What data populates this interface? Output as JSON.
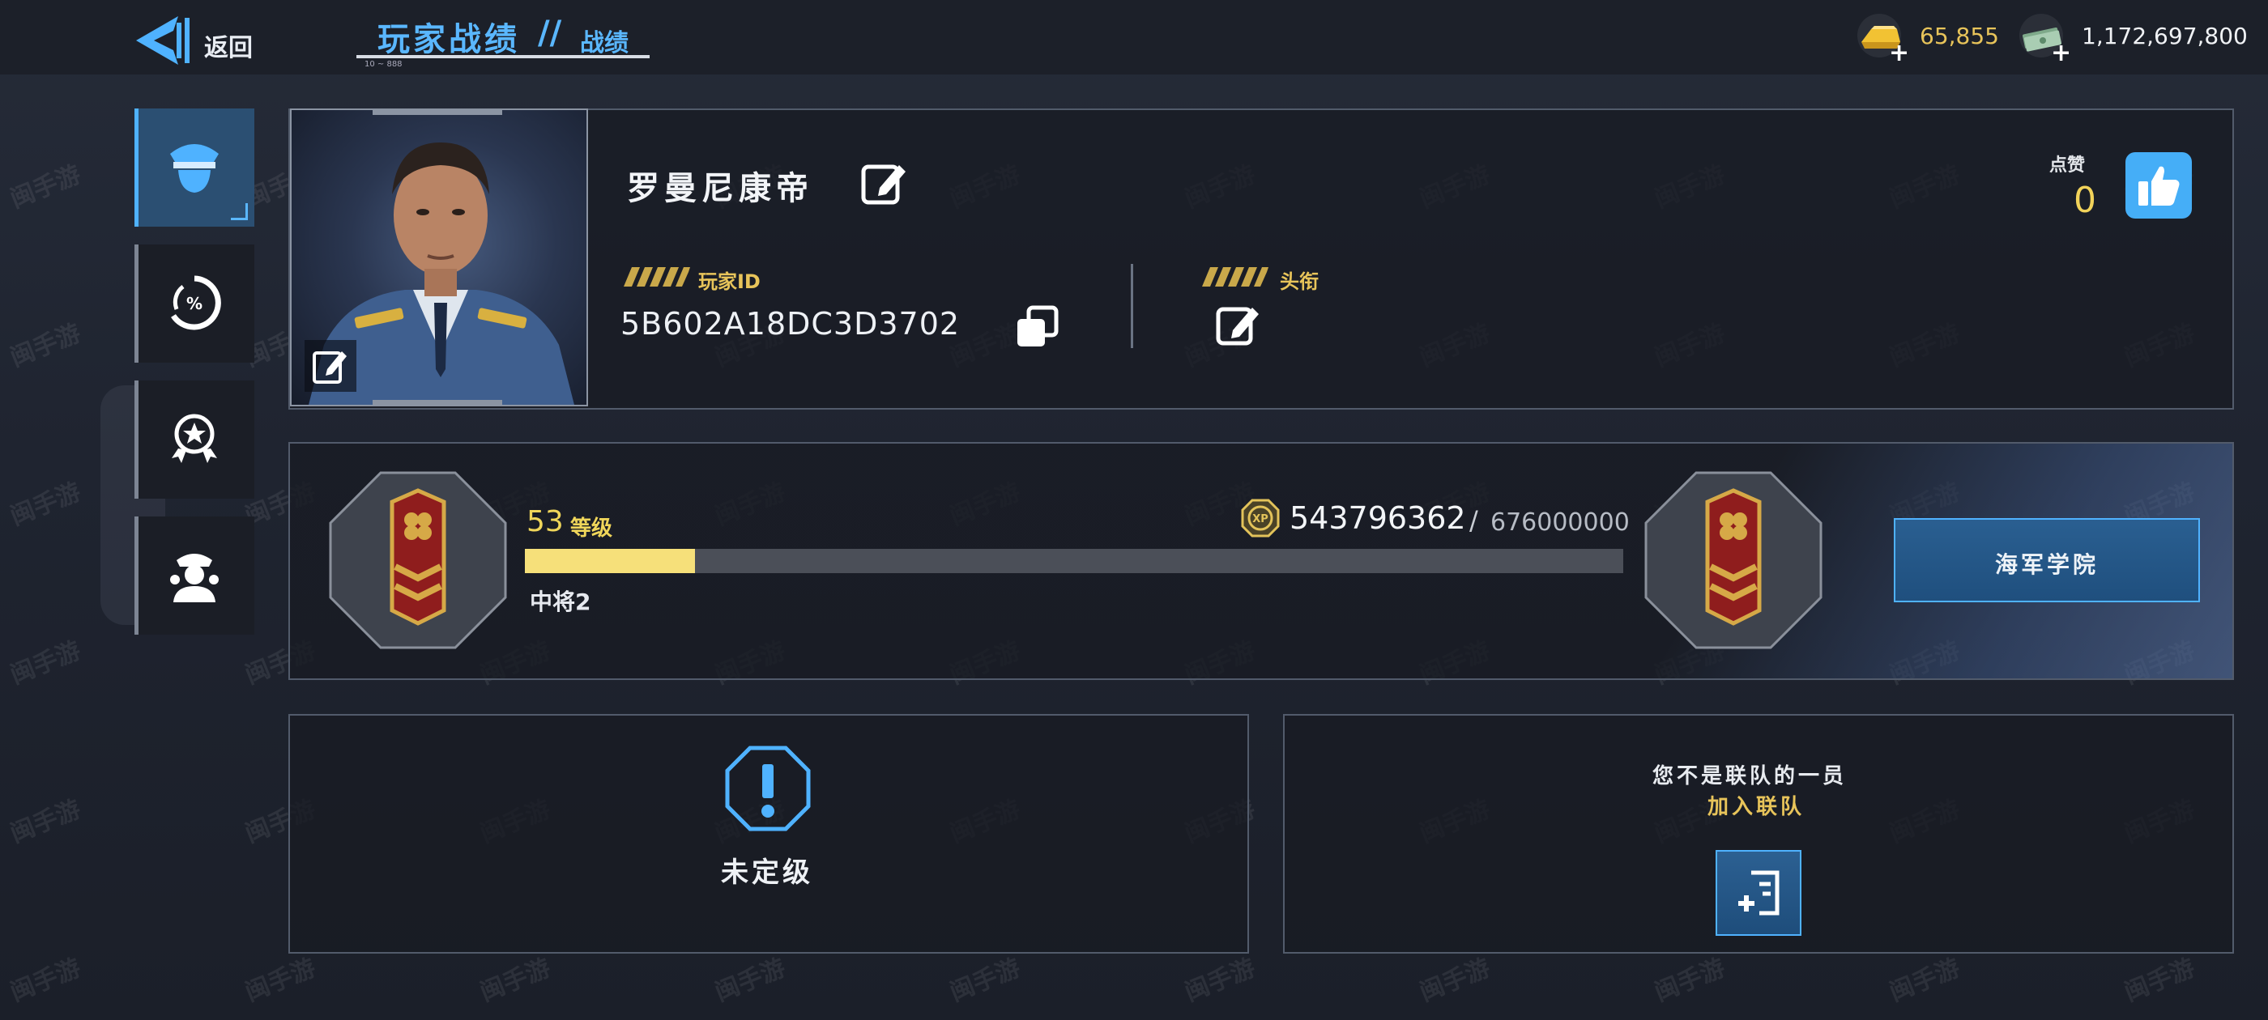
{
  "header": {
    "back_label": "返回",
    "title": "玩家战绩",
    "title_slash": "//",
    "subtitle": "战绩",
    "title_tiny": "10 ~ 888"
  },
  "currency": {
    "gold": {
      "icon": "gold-bar-icon",
      "value": "65,855"
    },
    "cash": {
      "icon": "cash-stack-icon",
      "value": "1,172,697,800"
    },
    "plus_label": "+"
  },
  "sidebar": {
    "tabs": [
      {
        "name": "officer",
        "icon": "officer-cap-icon",
        "active": true
      },
      {
        "name": "stats",
        "icon": "percent-gauge-icon",
        "active": false
      },
      {
        "name": "medals",
        "icon": "medal-icon",
        "active": false
      },
      {
        "name": "crew",
        "icon": "crew-icon",
        "active": false
      }
    ]
  },
  "profile": {
    "name": "罗曼尼康帝",
    "id_label": "玩家ID",
    "player_id": "5B602A18DC3D3702",
    "title_label": "头衔",
    "likes_label": "点赞",
    "likes_count": "0"
  },
  "level": {
    "level_number": "53",
    "level_word": "等级",
    "xp_icon_text": "XP",
    "xp_current": "543796362",
    "xp_separator": "/",
    "xp_target": "676000000",
    "xp_progress_fraction": 0.155,
    "rank_name": "中将2",
    "academy_button": "海军学院"
  },
  "rank": {
    "status": "未定级"
  },
  "alliance": {
    "status": "您不是联队的一员",
    "join_link": "加入联队"
  },
  "watermark": "闽手游",
  "colors": {
    "accent_blue": "#4fb2ff",
    "gold_text": "#e8c45a",
    "xp_fill": "#f6e07a",
    "panel_border": "#525b6b"
  }
}
